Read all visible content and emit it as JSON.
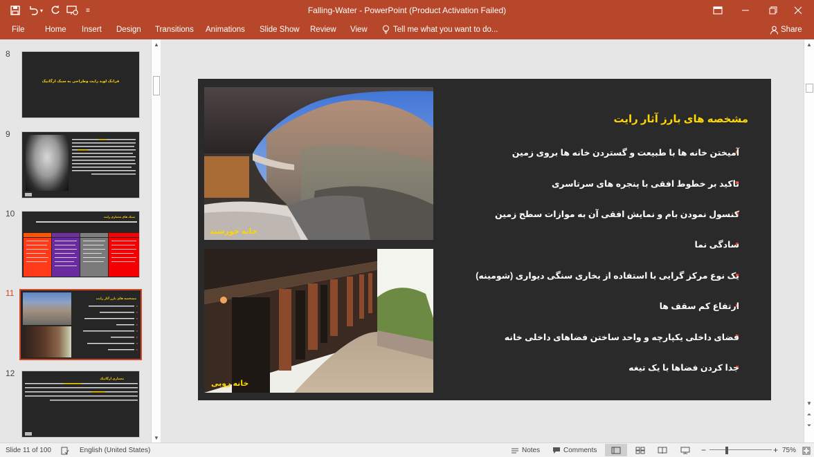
{
  "app": {
    "title": "Falling-Water - PowerPoint (Product Activation Failed)",
    "accent_color": "#b7472a"
  },
  "quick_access": {
    "icons": [
      "save-icon",
      "undo-icon",
      "undo-dropdown-icon",
      "redo-icon",
      "present-from-start-icon",
      "customize-icon"
    ]
  },
  "window_controls": {
    "icons": [
      "ribbon-display-options-icon",
      "minimize-icon",
      "restore-icon",
      "close-icon"
    ]
  },
  "ribbon": {
    "file": "File",
    "tabs": [
      "Home",
      "Insert",
      "Design",
      "Transitions",
      "Animations",
      "Slide Show",
      "Review",
      "View"
    ],
    "tell_me": "Tell me what you want to do...",
    "share": "Share"
  },
  "thumbnails": [
    {
      "number": "8",
      "title": "فرانک لوید رایت وطراحی به سبک ارگانیک"
    },
    {
      "number": "9"
    },
    {
      "number": "10",
      "title": "سبک های معماری رایت"
    },
    {
      "number": "11",
      "title": "مشخصه های بارز آثار رایت",
      "active": true
    },
    {
      "number": "12",
      "title": "معماری ارگانیک"
    }
  ],
  "slide": {
    "title": "مشخصه های بارز آثار رایت",
    "bullets": [
      "آمیختن خانه ها با طبیعت و گستردن خانه ها بروی زمین",
      "تاکید بر خطوط افقی  با پنجره های سرتاسری",
      "کنسول نمودن بام و نمایش افقی آن به موازات سطح زمین",
      "سادگی نما",
      "یک نوع مرکز گرایی با استفاده از بخاری سنگی دیواری (شومینه)",
      "ارتفاع کم سقف ها",
      "فضای داخلی یکپارچه و واحد ساختن فضاهای داخلی خانه",
      "جدا کردن فضاها با یک تیغه"
    ],
    "photo_captions": [
      "خانه خورشید",
      "خانه روبی"
    ],
    "title_color": "#ffd700",
    "bullet_color": "#e0412c"
  },
  "status": {
    "slide_info": "Slide 11 of 100",
    "language": "English (United States)",
    "notes": "Notes",
    "comments": "Comments",
    "zoom": "75%"
  }
}
